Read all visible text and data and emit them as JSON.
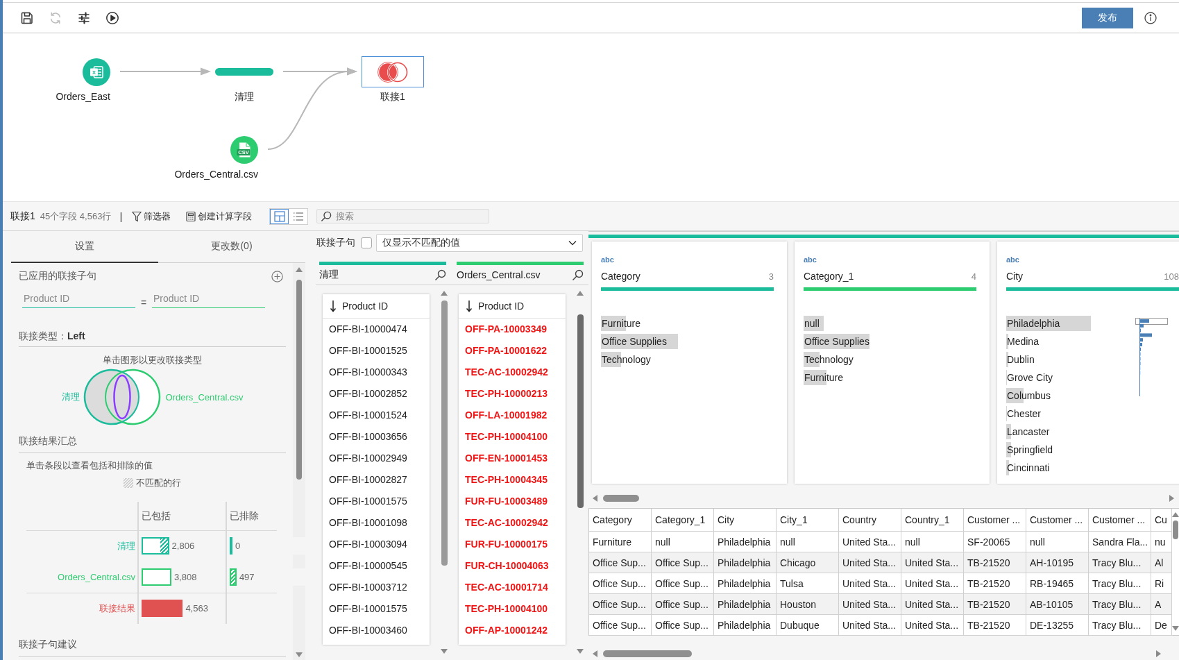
{
  "toolbar": [
    {
      "kind": "save",
      "disabled": false
    },
    {
      "kind": "refresh",
      "disabled": true
    },
    {
      "kind": "settings",
      "disabled": false
    },
    {
      "kind": "run",
      "disabled": false
    }
  ],
  "publish_button": "发布",
  "flow": {
    "kind": "join",
    "label": "联接1",
    "selected": true,
    "inputs": [
      {
        "kind": "clean",
        "label": "清理",
        "selected": false,
        "inputs": [
          {
            "kind": "excel",
            "label": "Orders_East",
            "icon_text": "X",
            "selected": false
          }
        ]
      },
      {
        "kind": "csv",
        "label": "Orders_Central.csv",
        "icon_text": "CSV",
        "selected": false
      }
    ]
  },
  "step_bar": {
    "name": "联接1",
    "stats": "45个字段 4,563行",
    "separator": "|",
    "actions": [
      {
        "kind": "filter",
        "label": "筛选器"
      },
      {
        "kind": "calc",
        "label": "创建计算字段"
      }
    ],
    "view_modes": [
      {
        "kind": "grid",
        "selected": true
      },
      {
        "kind": "list",
        "selected": false
      }
    ],
    "search": {
      "placeholder": "搜索"
    }
  },
  "settings_panel": {
    "tabs": [
      {
        "label": "设置",
        "selected": true
      },
      {
        "label": "更改数(0)",
        "selected": false
      }
    ],
    "applied_clauses": {
      "title": "已应用的联接子句",
      "clauses": [
        {
          "left": "Product ID",
          "operator": "=",
          "right": "Product ID"
        }
      ]
    },
    "join_type": {
      "label": "联接类型：",
      "value": "Left"
    },
    "venn": {
      "hint": "单击图形以更改联接类型",
      "sides": [
        {
          "label": "清理",
          "filled": true
        },
        {
          "label": "Orders_Central.csv",
          "filled": false
        }
      ],
      "inner_filled": true
    },
    "summary": {
      "title": "联接结果汇总",
      "hint": "单击条段以查看包括和排除的值",
      "legend": "不匹配的行",
      "columns": [
        "已包括",
        "已排除"
      ],
      "rows": [
        {
          "label": "清理",
          "color": "#1abc9c",
          "kind": "input",
          "included": {
            "value": "2,806",
            "level": 0.36,
            "hatched": false,
            "unmatched": {
              "level": 0.33
            }
          },
          "excluded": {
            "value": "0",
            "level": 0.036
          }
        },
        {
          "label": "Orders_Central.csv",
          "color": "#2ecc71",
          "kind": "input",
          "included": {
            "value": "3,808",
            "level": 0.39,
            "hatched": false
          },
          "excluded": {
            "value": "497",
            "level": 0.09,
            "hatched": true
          }
        },
        {
          "label": "联接结果",
          "color": "#e05252",
          "kind": "result",
          "included": {
            "value": "4,563",
            "level": 0.54,
            "hatched": false
          }
        }
      ]
    },
    "suggestions": {
      "title": "联接子句建议"
    }
  },
  "join_clause": {
    "label": "联接子句",
    "checkbox": {
      "checked": false
    },
    "filter": {
      "value": "仅显示不匹配的值"
    }
  },
  "sources": [
    {
      "name": "清理",
      "color": "#1abc9c",
      "field": "Product ID",
      "rows": [
        {
          "text": "OFF-BI-10000474",
          "unmatched": false
        },
        {
          "text": "OFF-BI-10001525",
          "unmatched": false
        },
        {
          "text": "OFF-BI-10000343",
          "unmatched": false
        },
        {
          "text": "OFF-BI-10002852",
          "unmatched": false
        },
        {
          "text": "OFF-BI-10001524",
          "unmatched": false
        },
        {
          "text": "OFF-BI-10003656",
          "unmatched": false
        },
        {
          "text": "OFF-BI-10002949",
          "unmatched": false
        },
        {
          "text": "OFF-BI-10002827",
          "unmatched": false
        },
        {
          "text": "OFF-BI-10001575",
          "unmatched": false
        },
        {
          "text": "OFF-BI-10001098",
          "unmatched": false
        },
        {
          "text": "OFF-BI-10003094",
          "unmatched": false
        },
        {
          "text": "OFF-BI-10000545",
          "unmatched": false
        },
        {
          "text": "OFF-BI-10003712",
          "unmatched": false
        },
        {
          "text": "OFF-BI-10001575",
          "unmatched": false
        },
        {
          "text": "OFF-BI-10003460",
          "unmatched": false
        }
      ]
    },
    {
      "name": "Orders_Central.csv",
      "color": "#2ecc71",
      "field": "Product ID",
      "rows": [
        {
          "text": "OFF-PA-10003349",
          "unmatched": true
        },
        {
          "text": "OFF-PA-10001622",
          "unmatched": true
        },
        {
          "text": "TEC-AC-10002942",
          "unmatched": true
        },
        {
          "text": "TEC-PH-10000213",
          "unmatched": true
        },
        {
          "text": "OFF-LA-10001982",
          "unmatched": true
        },
        {
          "text": "TEC-PH-10004100",
          "unmatched": true
        },
        {
          "text": "OFF-EN-10001453",
          "unmatched": true
        },
        {
          "text": "TEC-PH-10004345",
          "unmatched": true
        },
        {
          "text": "FUR-FU-10003489",
          "unmatched": true
        },
        {
          "text": "TEC-AC-10002942",
          "unmatched": true
        },
        {
          "text": "FUR-FU-10000175",
          "unmatched": true
        },
        {
          "text": "FUR-CH-10004063",
          "unmatched": true
        },
        {
          "text": "TEC-AC-10001714",
          "unmatched": true
        },
        {
          "text": "TEC-PH-10004100",
          "unmatched": true
        },
        {
          "text": "OFF-AP-10001242",
          "unmatched": true
        }
      ]
    }
  ],
  "profile": [
    {
      "type": "abc",
      "name": "Category",
      "count": "3",
      "color": "#1abc9c",
      "kind": "plain",
      "values": [
        {
          "text": "Furniture",
          "level": 0.28
        },
        {
          "text": "Office Supplies",
          "level": 0.85
        },
        {
          "text": "Technology",
          "level": 0.22
        }
      ]
    },
    {
      "type": "abc",
      "name": "Category_1",
      "count": "4",
      "color": "#2ecc71",
      "kind": "plain",
      "values": [
        {
          "text": "null",
          "level": 0.22
        },
        {
          "text": "Office Supplies",
          "level": 0.73
        },
        {
          "text": "Technology",
          "level": 0.18
        },
        {
          "text": "Furniture",
          "level": 0.25
        }
      ]
    },
    {
      "type": "abc",
      "name": "City",
      "count": "108",
      "color": "#1abc9c",
      "kind": "histogram",
      "values": [
        {
          "text": "Philadelphia",
          "level": 0.94
        },
        {
          "text": "Medina",
          "level": 0.02
        },
        {
          "text": "Dublin",
          "level": 0.02
        },
        {
          "text": "Grove City",
          "level": 0.01
        },
        {
          "text": "Columbus",
          "level": 0.19
        },
        {
          "text": "Chester",
          "level": 0.01
        },
        {
          "text": "Lancaster",
          "level": 0.05
        },
        {
          "text": "Springfield",
          "level": 0.05
        },
        {
          "text": "Cincinnati",
          "level": 0.03
        }
      ]
    }
  ],
  "table": {
    "columns": [
      "Category",
      "Category_1",
      "City",
      "City_1",
      "Country",
      "Country_1",
      "Customer ...",
      "Customer ...",
      "Customer ...",
      "Cu"
    ],
    "rows": [
      [
        "Furniture",
        "null",
        "Philadelphia",
        "null",
        "United Sta...",
        "null",
        "SF-20065",
        "null",
        "Sandra Fla...",
        "nu"
      ],
      [
        "Office Sup...",
        "Office Sup...",
        "Philadelphia",
        "Chicago",
        "United Sta...",
        "United Sta...",
        "TB-21520",
        "AH-10195",
        "Tracy Blu...",
        "Al"
      ],
      [
        "Office Sup...",
        "Office Sup...",
        "Philadelphia",
        "Tulsa",
        "United Sta...",
        "United Sta...",
        "TB-21520",
        "RB-19465",
        "Tracy Blu...",
        "Ri"
      ],
      [
        "Office Sup...",
        "Office Sup...",
        "Philadelphia",
        "Houston",
        "United Sta...",
        "United Sta...",
        "TB-21520",
        "AB-10105",
        "Tracy Blu...",
        "A"
      ],
      [
        "Office Sup...",
        "Office Sup...",
        "Philadelphia",
        "Dubuque",
        "United Sta...",
        "United Sta...",
        "TB-21520",
        "DE-13255",
        "Tracy Blu...",
        "De"
      ]
    ]
  }
}
